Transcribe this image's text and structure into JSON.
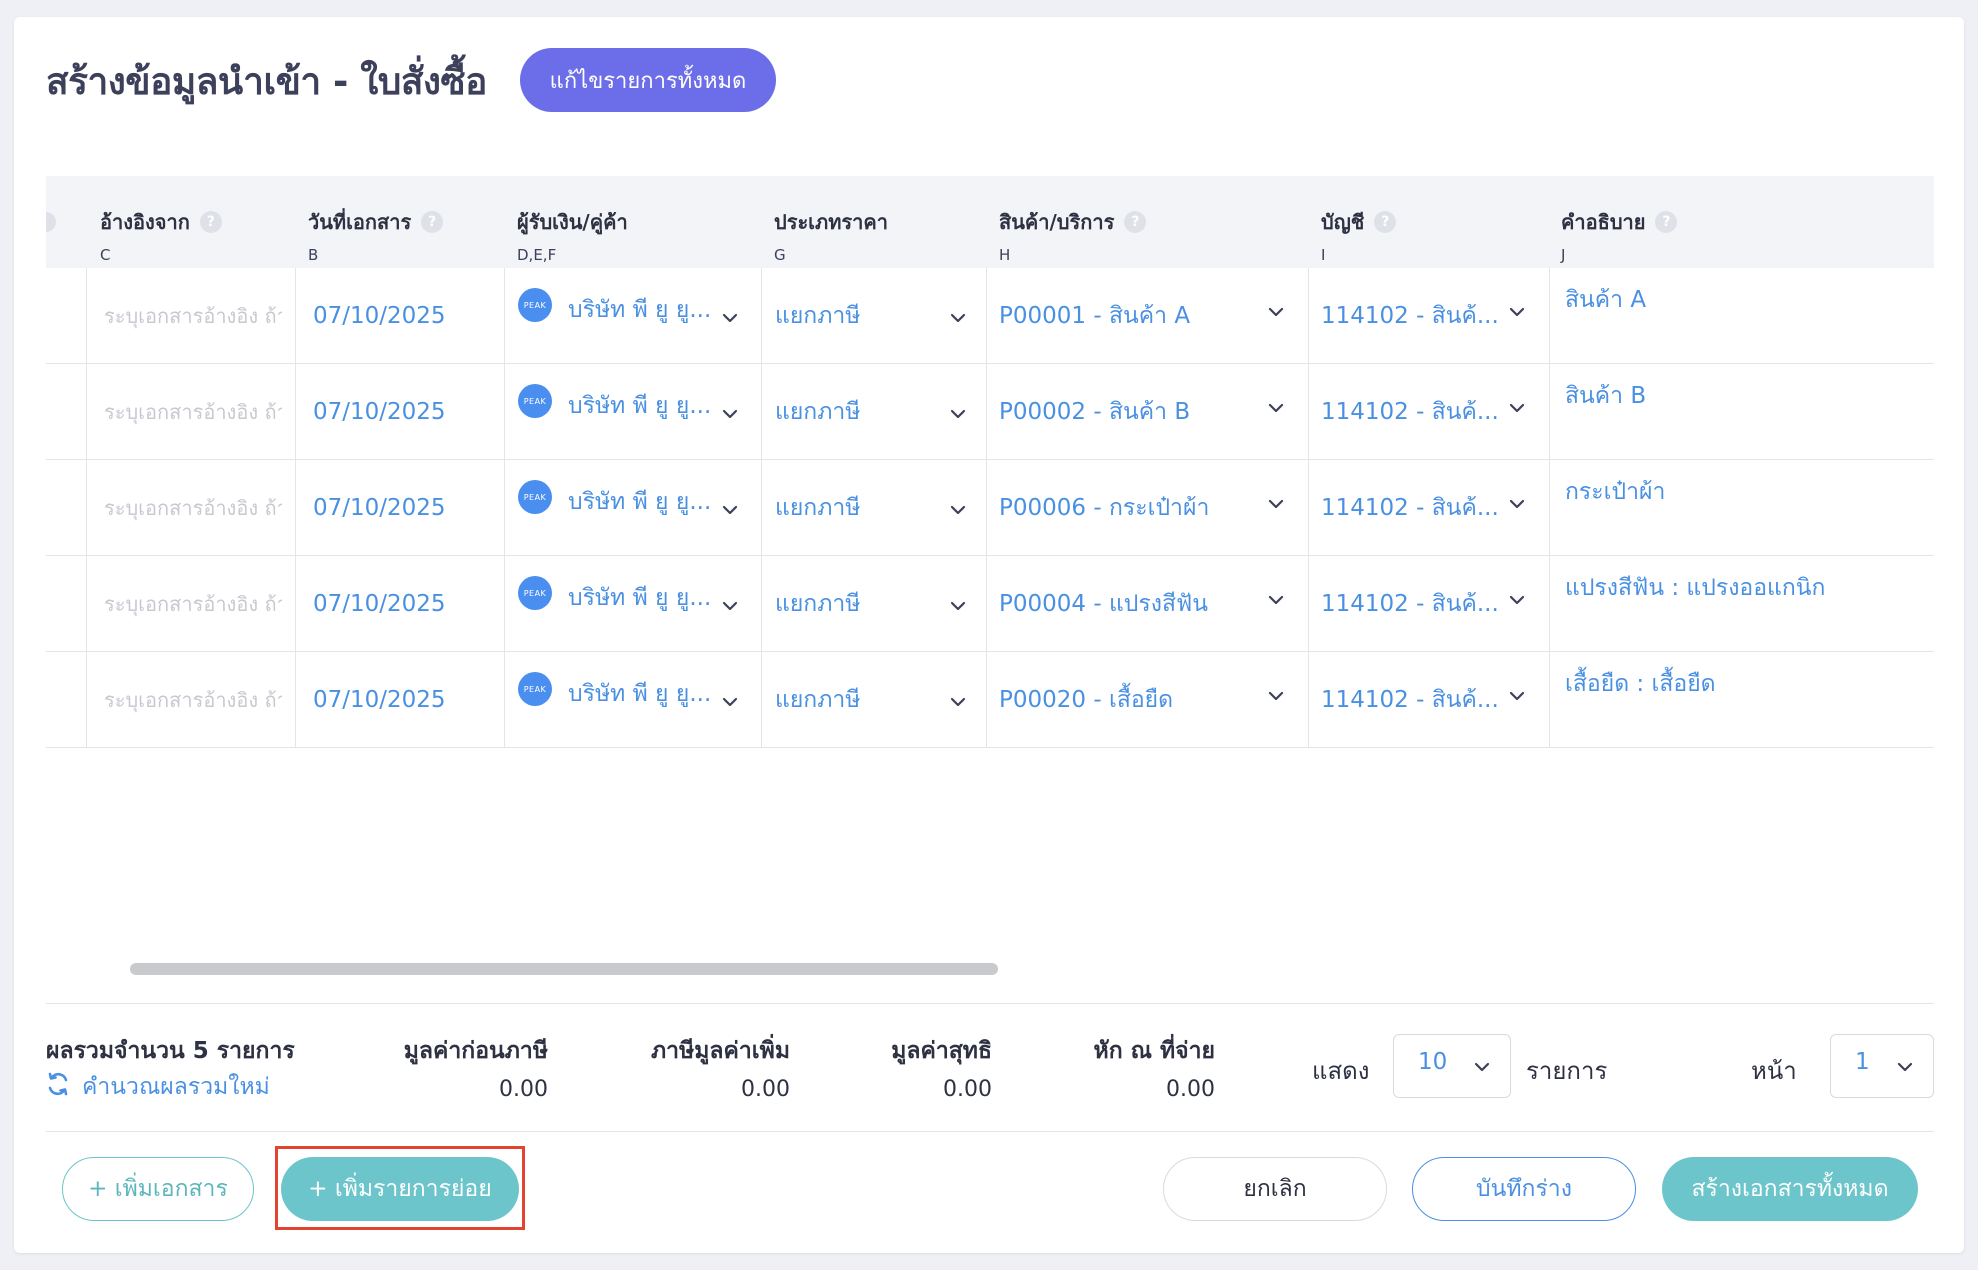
{
  "page": {
    "title": "สร้างข้อมูลนำเข้า - ใบสั่งซื้อ",
    "edit_all_label": "แก้ไขรายการทั้งหมด"
  },
  "table": {
    "columns": [
      {
        "title": "อ้างอิงจาก",
        "code": "C"
      },
      {
        "title": "วันที่เอกสาร",
        "code": "B"
      },
      {
        "title": "ผู้รับเงิน/คู่ค้า",
        "code": "D,E,F"
      },
      {
        "title": "ประเภทราคา",
        "code": "G"
      },
      {
        "title": "สินค้า/บริการ",
        "code": "H"
      },
      {
        "title": "บัญชี",
        "code": "I"
      },
      {
        "title": "คำอธิบาย",
        "code": "J"
      }
    ],
    "help_glyph": "?",
    "ref_placeholder": "ระบุเอกสารอ้างอิง ถ้ามี",
    "logo_text": "PEAK",
    "rows": [
      {
        "date": "07/10/2025",
        "contact": "บริษัท พี ยู ยู...",
        "price_type": "แยกภาษี",
        "product": "P00001 - สินค้า A",
        "account": "114102 - สินค้...",
        "description": "สินค้า A"
      },
      {
        "date": "07/10/2025",
        "contact": "บริษัท พี ยู ยู...",
        "price_type": "แยกภาษี",
        "product": "P00002 - สินค้า B",
        "account": "114102 - สินค้...",
        "description": "สินค้า B"
      },
      {
        "date": "07/10/2025",
        "contact": "บริษัท พี ยู ยู...",
        "price_type": "แยกภาษี",
        "product": "P00006 - กระเป๋าผ้า",
        "account": "114102 - สินค้...",
        "description": "กระเป๋าผ้า"
      },
      {
        "date": "07/10/2025",
        "contact": "บริษัท พี ยู ยู...",
        "price_type": "แยกภาษี",
        "product": "P00004 - แปรงสีฟัน",
        "account": "114102 - สินค้...",
        "description": "แปรงสีฟัน : แปรงออแกนิก"
      },
      {
        "date": "07/10/2025",
        "contact": "บริษัท พี ยู ยู...",
        "price_type": "แยกภาษี",
        "product": "P00020 - เสื้อยืด",
        "account": "114102 - สินค้...",
        "description": "เสื้อยืด : เสื้อยืด"
      }
    ]
  },
  "summary": {
    "total_label": "ผลรวมจำนวน 5 รายการ",
    "recalc_label": "คำนวณผลรวมใหม่",
    "columns": [
      {
        "label": "มูลค่าก่อนภาษี",
        "value": "0.00"
      },
      {
        "label": "ภาษีมูลค่าเพิ่ม",
        "value": "0.00"
      },
      {
        "label": "มูลค่าสุทธิ",
        "value": "0.00"
      },
      {
        "label": "หัก ณ ที่จ่าย",
        "value": "0.00"
      }
    ]
  },
  "pagination": {
    "show_label": "แสดง",
    "page_size": "10",
    "items_label": "รายการ",
    "page_label": "หน้า",
    "page": "1"
  },
  "actions": {
    "add_document": "+ เพิ่มเอกสาร",
    "add_line": "+ เพิ่มรายการย่อย",
    "cancel": "ยกเลิก",
    "save_draft": "บันทึกร่าง",
    "create_all": "สร้างเอกสารทั้งหมด"
  },
  "colors": {
    "accent_purple": "#6b6ee8",
    "teal": "#6cc5ca",
    "link_blue": "#4a90e2",
    "highlight_red": "#e2452f"
  }
}
